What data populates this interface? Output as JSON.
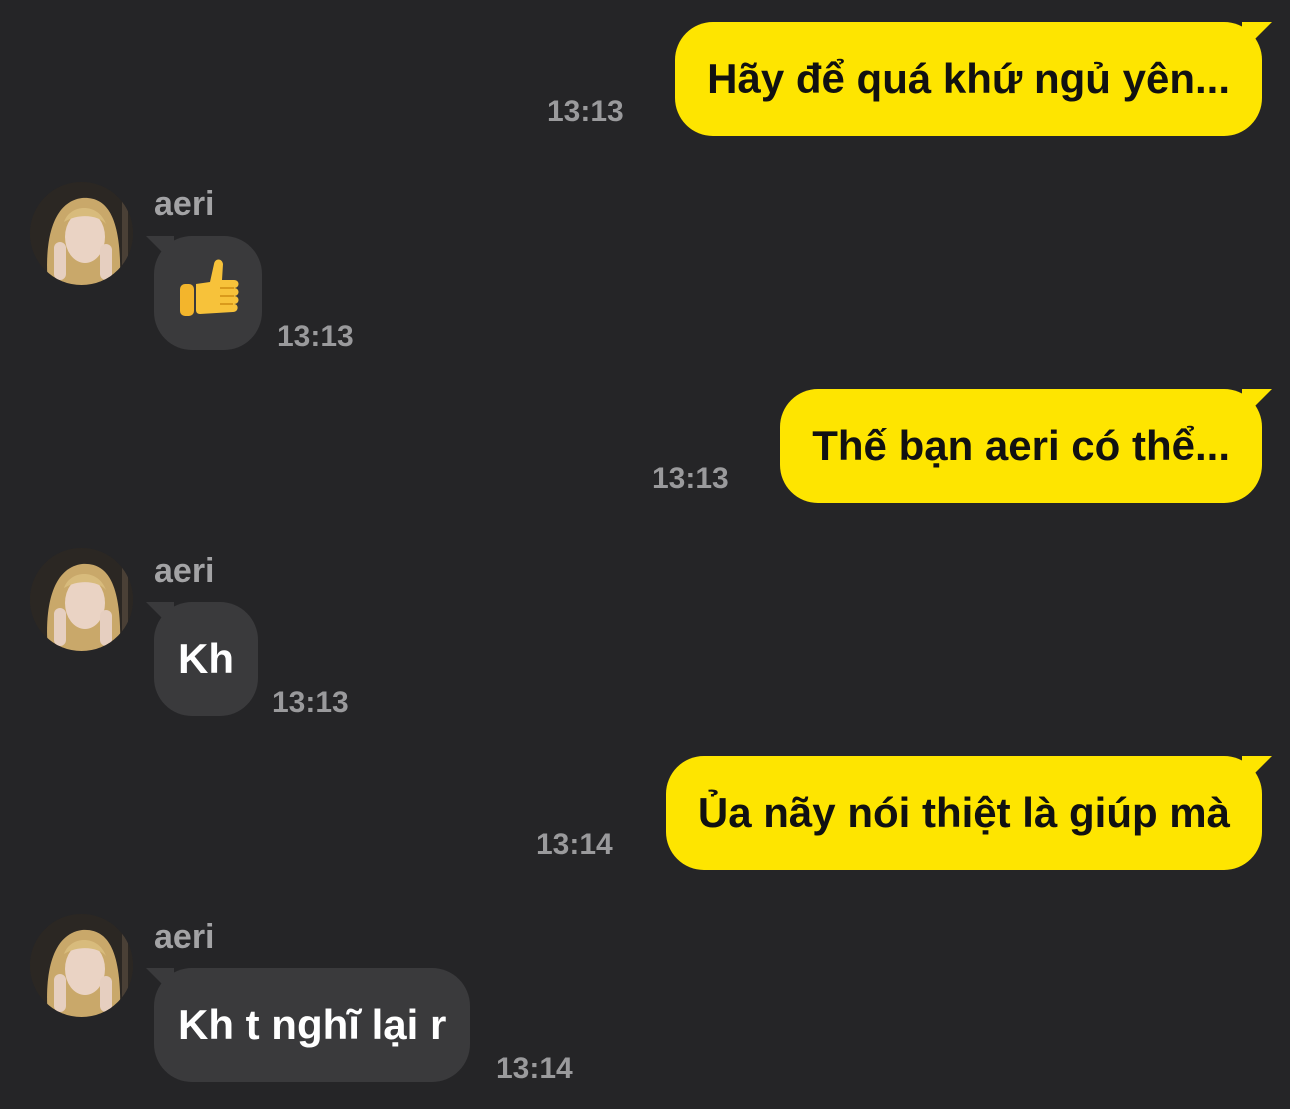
{
  "messages": [
    {
      "dir": "out",
      "text": "Hãy để quá khứ ngủ yên...",
      "time": "13:13"
    },
    {
      "dir": "in",
      "sender": "aeri",
      "text": "👍",
      "time": "13:13"
    },
    {
      "dir": "out",
      "text": "Thế bạn aeri có thể...",
      "time": "13:13"
    },
    {
      "dir": "in",
      "sender": "aeri",
      "text": "Kh",
      "time": "13:13"
    },
    {
      "dir": "out",
      "text": "Ủa nãy nói thiệt là giúp mà",
      "time": "13:14"
    },
    {
      "dir": "in",
      "sender": "aeri",
      "text": "Kh t nghĩ lại r",
      "time": "13:14"
    }
  ],
  "colors": {
    "background": "#252527",
    "outgoing_bubble": "#FEE500",
    "incoming_bubble": "#3a3a3c",
    "timestamp": "#9a9a9c"
  },
  "icons": {
    "avatar": "user-avatar-photo",
    "thumbs_up": "thumbs-up-emoji"
  }
}
